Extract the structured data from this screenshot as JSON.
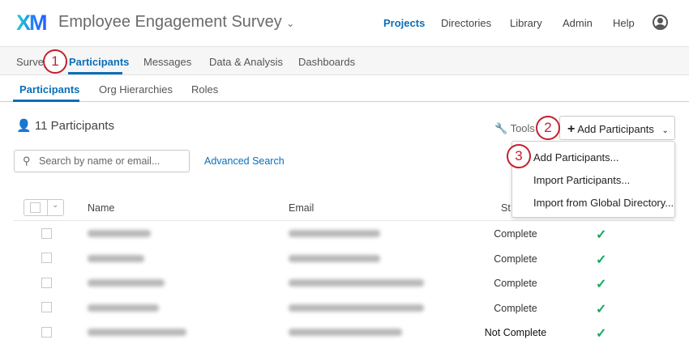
{
  "header": {
    "logo": "XM",
    "title": "Employee Engagement Survey",
    "nav": [
      "Projects",
      "Directories",
      "Library",
      "Admin",
      "Help"
    ]
  },
  "tabs": [
    "Survey",
    "Participants",
    "Messages",
    "Data & Analysis",
    "Dashboards"
  ],
  "subtabs": [
    "Participants",
    "Org Hierarchies",
    "Roles"
  ],
  "callouts": [
    "1",
    "2",
    "3"
  ],
  "toolbar": {
    "count": "11 Participants",
    "tools": "Tools",
    "add": "Add Participants",
    "search_placeholder": "Search by name or email...",
    "advanced": "Advanced Search"
  },
  "menu": [
    "Add Participants...",
    "Import Participants...",
    "Import from Global Directory..."
  ],
  "table": {
    "headers": [
      "Name",
      "Email",
      "St"
    ],
    "rows": [
      {
        "status": "Complete"
      },
      {
        "status": "Complete"
      },
      {
        "status": "Complete"
      },
      {
        "status": "Complete"
      },
      {
        "status": "Not Complete"
      }
    ]
  },
  "colors": {
    "accent": "#0b6fb8",
    "callout": "#c2202e",
    "check": "#17a862"
  }
}
